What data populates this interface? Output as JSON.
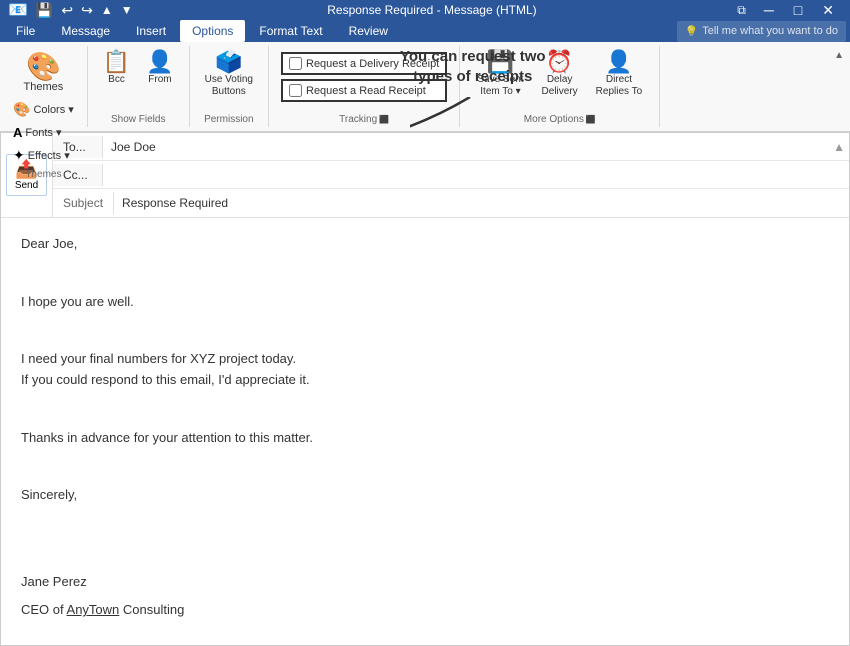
{
  "titleBar": {
    "title": "Response Required - Message (HTML)",
    "controls": [
      "minimize",
      "restore",
      "close"
    ],
    "icons": [
      "save",
      "undo",
      "redo",
      "up",
      "down"
    ]
  },
  "menuBar": {
    "items": [
      "File",
      "Message",
      "Insert",
      "Options",
      "Format Text",
      "Review"
    ],
    "active": "Options",
    "search": "Tell me what you want to do"
  },
  "ribbon": {
    "groups": [
      {
        "id": "themes",
        "label": "Themes",
        "buttons": [
          {
            "id": "themes-btn",
            "label": "Themes",
            "icon": "🎨"
          },
          {
            "id": "colors-btn",
            "label": "Colors ▾",
            "icon": "🎨"
          },
          {
            "id": "fonts-btn",
            "label": "Fonts ▾",
            "icon": "A"
          },
          {
            "id": "effects-btn",
            "label": "Effects ▾",
            "icon": "✦"
          }
        ]
      },
      {
        "id": "show-fields",
        "label": "Show Fields",
        "buttons": [
          {
            "id": "bcc-btn",
            "label": "Bcc",
            "icon": "📋"
          },
          {
            "id": "from-btn",
            "label": "From",
            "icon": "👤"
          }
        ]
      },
      {
        "id": "permission",
        "label": "Permission",
        "buttons": [
          {
            "id": "use-voting-btn",
            "label": "Use Voting\nButtons",
            "icon": "🗳️"
          }
        ]
      },
      {
        "id": "tracking",
        "label": "Tracking",
        "checkboxes": [
          {
            "id": "delivery-receipt",
            "label": "Request a Delivery Receipt",
            "checked": false
          },
          {
            "id": "read-receipt",
            "label": "Request a Read Receipt",
            "checked": false
          }
        ],
        "expandIcon": "⬛"
      },
      {
        "id": "more-options",
        "label": "More Options",
        "buttons": [
          {
            "id": "save-sent-btn",
            "label": "Save Sent\nItem To ▾",
            "icon": "💾"
          },
          {
            "id": "delay-delivery-btn",
            "label": "Delay\nDelivery",
            "icon": "⏰"
          },
          {
            "id": "direct-replies-btn",
            "label": "Direct\nReplies To",
            "icon": "👤"
          }
        ],
        "expandIcon": "⬛"
      }
    ]
  },
  "emailFields": {
    "to": {
      "label": "To...",
      "value": "Joe Doe"
    },
    "cc": {
      "label": "Cc..."
    },
    "subject": {
      "label": "Subject",
      "value": "Response Required"
    }
  },
  "sendButton": {
    "label": "Send"
  },
  "emailBody": {
    "lines": [
      "Dear Joe,",
      "",
      "I hope you are well.",
      "",
      "I need your final numbers for XYZ project today.",
      "If you could respond to this email, I'd appreciate it.",
      "",
      "Thanks in advance for your attention to this matter.",
      "",
      "Sincerely,",
      "",
      "",
      "Jane Perez",
      "CEO of AnyTown Consulting"
    ]
  },
  "annotation": {
    "text": "You can request two\ntypes of receipts",
    "arrowFrom": "text",
    "arrowTo": "checkboxes"
  }
}
